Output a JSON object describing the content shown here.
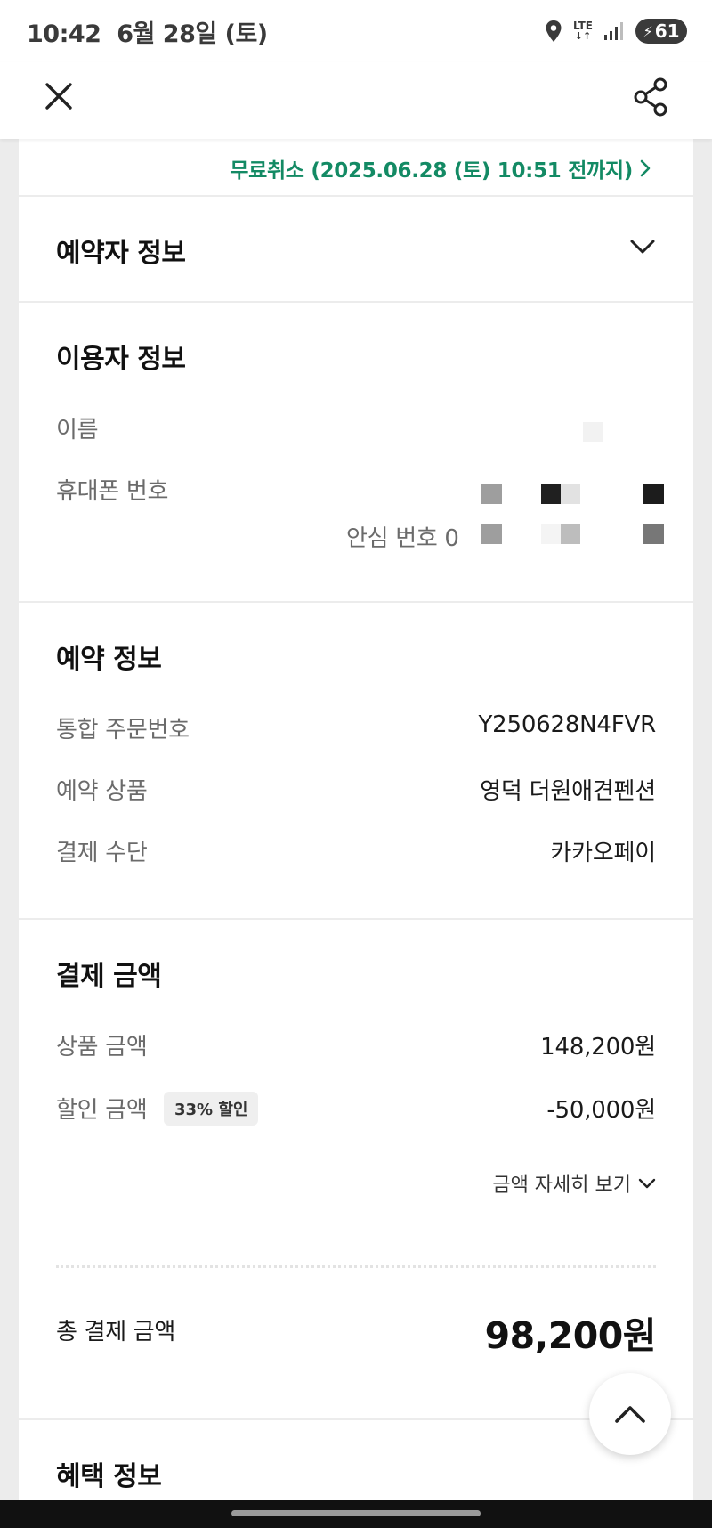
{
  "status_bar": {
    "time": "10:42",
    "date": "6월 28일 (토)",
    "network": "LTE",
    "battery": "61"
  },
  "header": {
    "close_icon": "close-icon",
    "share_icon": "share-icon"
  },
  "cancel": {
    "text": "무료취소 (2025.06.28 (토) 10:51 전까지)",
    "color": "#138a64"
  },
  "booker": {
    "title": "예약자 정보"
  },
  "user": {
    "title": "이용자 정보",
    "name_label": "이름",
    "phone_label": "휴대폰 번호",
    "safe_number_label": "안심 번호 0"
  },
  "reservation": {
    "title": "예약 정보",
    "rows": [
      {
        "label": "통합 주문번호",
        "value": "Y250628N4FVR"
      },
      {
        "label": "예약 상품",
        "value": "영덕 더원애견펜션"
      },
      {
        "label": "결제 수단",
        "value": "카카오페이"
      }
    ]
  },
  "payment": {
    "title": "결제 금액",
    "product_label": "상품 금액",
    "product_value": "148,200원",
    "discount_label": "할인 금액",
    "discount_badge": "33% 할인",
    "discount_value": "-50,000원",
    "detail_link": "금액 자세히 보기",
    "total_label": "총 결제 금액",
    "total_value": "98,200원"
  },
  "benefit": {
    "title": "혜택 정보"
  }
}
